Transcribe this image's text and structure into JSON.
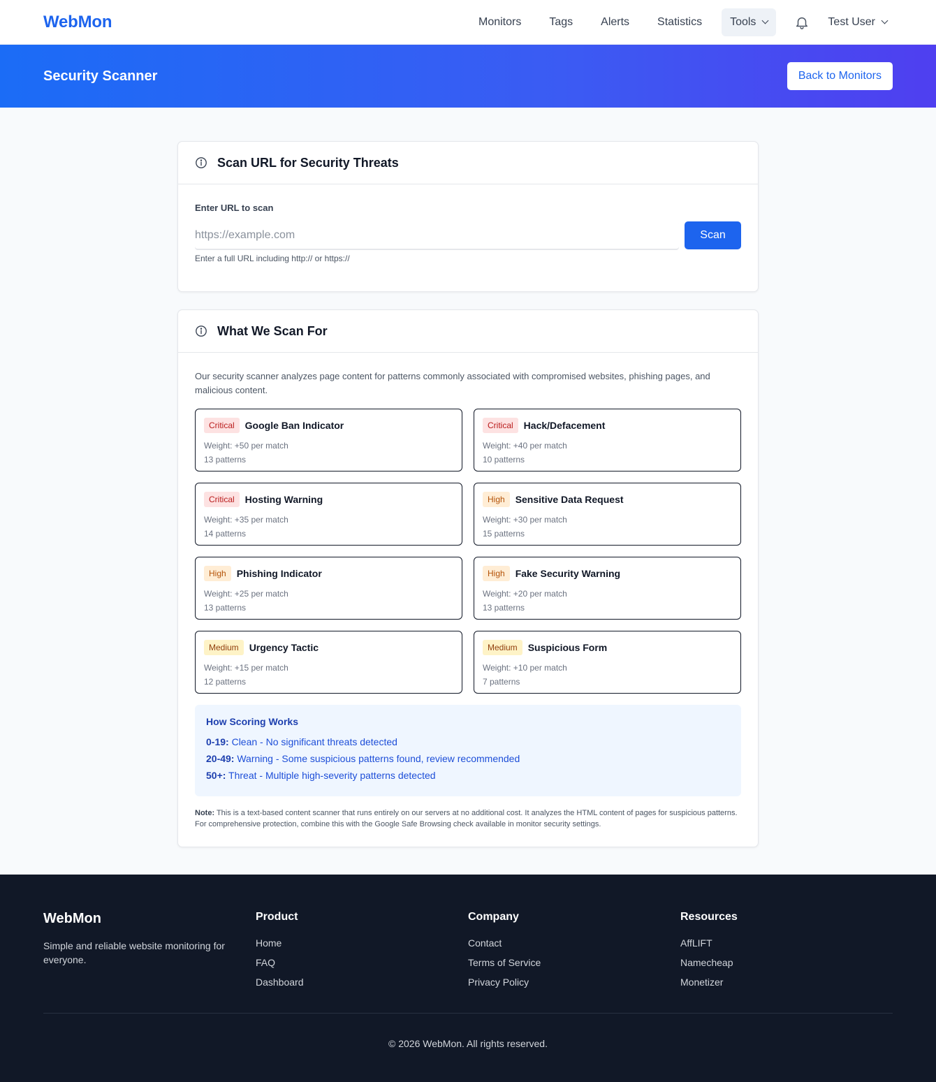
{
  "nav": {
    "brand": "WebMon",
    "links": [
      "Monitors",
      "Tags",
      "Alerts",
      "Statistics"
    ],
    "tools_label": "Tools",
    "user_label": "Test User"
  },
  "hero": {
    "title": "Security Scanner",
    "back_label": "Back to Monitors"
  },
  "scan_card": {
    "title": "Scan URL for Security Threats",
    "field_label": "Enter URL to scan",
    "placeholder": "https://example.com",
    "value": "",
    "scan_label": "Scan",
    "help": "Enter a full URL including http:// or https://"
  },
  "what_card": {
    "title": "What We Scan For",
    "intro": "Our security scanner analyzes page content for patterns commonly associated with compromised websites, phishing pages, and malicious content.",
    "categories": [
      {
        "severity": "Critical",
        "name": "Google Ban Indicator",
        "weight": "Weight: +50 per match",
        "patterns": "13 patterns"
      },
      {
        "severity": "Critical",
        "name": "Hack/Defacement",
        "weight": "Weight: +40 per match",
        "patterns": "10 patterns"
      },
      {
        "severity": "Critical",
        "name": "Hosting Warning",
        "weight": "Weight: +35 per match",
        "patterns": "14 patterns"
      },
      {
        "severity": "High",
        "name": "Sensitive Data Request",
        "weight": "Weight: +30 per match",
        "patterns": "15 patterns"
      },
      {
        "severity": "High",
        "name": "Phishing Indicator",
        "weight": "Weight: +25 per match",
        "patterns": "13 patterns"
      },
      {
        "severity": "High",
        "name": "Fake Security Warning",
        "weight": "Weight: +20 per match",
        "patterns": "13 patterns"
      },
      {
        "severity": "Medium",
        "name": "Urgency Tactic",
        "weight": "Weight: +15 per match",
        "patterns": "12 patterns"
      },
      {
        "severity": "Medium",
        "name": "Suspicious Form",
        "weight": "Weight: +10 per match",
        "patterns": "7 patterns"
      }
    ],
    "scoring": {
      "title": "How Scoring Works",
      "lines": [
        {
          "range": "0-19:",
          "text": " Clean - No significant threats detected"
        },
        {
          "range": "20-49:",
          "text": " Warning - Some suspicious patterns found, review recommended"
        },
        {
          "range": "50+:",
          "text": " Threat - Multiple high-severity patterns detected"
        }
      ]
    },
    "note_label": "Note:",
    "note_text": " This is a text-based content scanner that runs entirely on our servers at no additional cost. It analyzes the HTML content of pages for suspicious patterns. For comprehensive protection, combine this with the Google Safe Browsing check available in monitor security settings."
  },
  "footer": {
    "brand": "WebMon",
    "tagline": "Simple and reliable website monitoring for everyone.",
    "columns": [
      {
        "heading": "Product",
        "links": [
          "Home",
          "FAQ",
          "Dashboard"
        ]
      },
      {
        "heading": "Company",
        "links": [
          "Contact",
          "Terms of Service",
          "Privacy Policy"
        ]
      },
      {
        "heading": "Resources",
        "links": [
          "AffLIFT",
          "Namecheap",
          "Monetizer"
        ]
      }
    ],
    "copyright": "© 2026 WebMon. All rights reserved."
  },
  "colors": {
    "accent": "#1d64ee",
    "critical_bg": "#fde2e2",
    "high_bg": "#ffedd5",
    "medium_bg": "#fef3c7",
    "footer_bg": "#111827"
  },
  "icons": [
    "chevron-down-icon",
    "bell-icon",
    "info-icon"
  ]
}
